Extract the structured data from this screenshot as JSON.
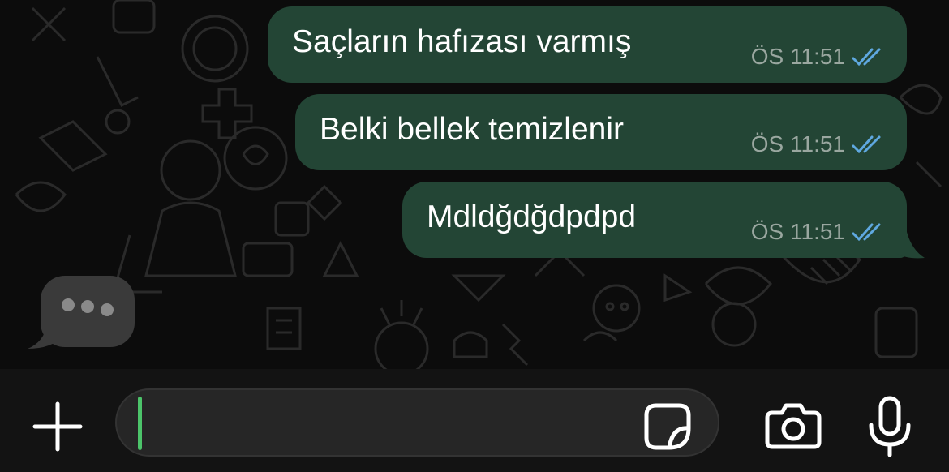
{
  "colors": {
    "outgoing_bubble": "#234535",
    "read_receipt": "#5fa8e0",
    "caret": "#4cc46a",
    "background": "#0c0c0c"
  },
  "messages": [
    {
      "text": "Saçların hafızası varmış",
      "time": "ÖS 11:51",
      "status": "read"
    },
    {
      "text": "Belki bellek temizlenir",
      "time": "ÖS 11:51",
      "status": "read"
    },
    {
      "text": "Mdldğdğdpdpd",
      "time": "ÖS 11:51",
      "status": "read"
    }
  ],
  "typing_indicator": {
    "icon": "typing-dots-icon"
  },
  "input_bar": {
    "attach_icon": "plus-icon",
    "message_value": "",
    "sticker_icon": "sticker-icon",
    "camera_icon": "camera-icon",
    "mic_icon": "microphone-icon"
  }
}
